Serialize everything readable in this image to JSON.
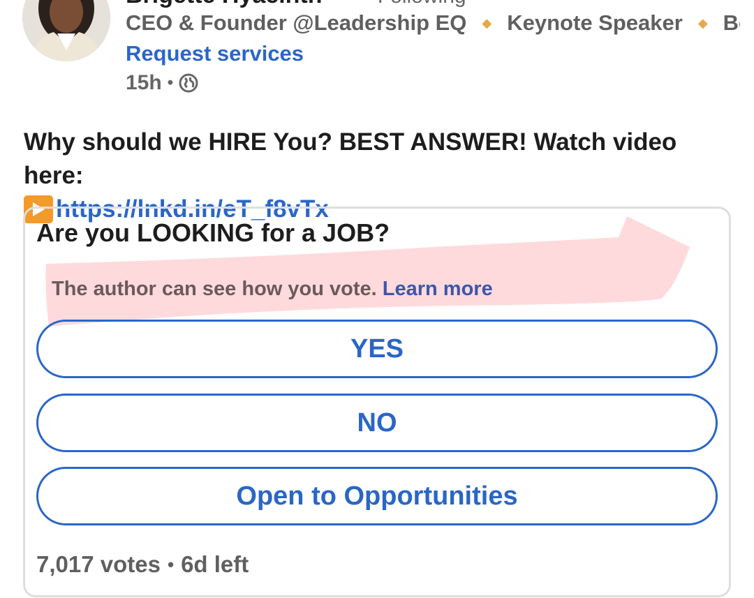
{
  "post": {
    "author": {
      "name": "Brigette Hyacinth",
      "follow_status": "• Following",
      "headline": [
        "CEO & Founder @Leadership EQ",
        "Keynote Speaker",
        "Be…"
      ],
      "headline_separator": "◆",
      "request_services": "Request services",
      "time_ago": "15h",
      "meta_dot": "•",
      "visibility_icon": "globe-icon"
    },
    "text": "Why should we HIRE You? BEST ANSWER! Watch video here:",
    "link": "https://lnkd.in/eT_f8vTx",
    "play_icon": "play-button-icon"
  },
  "poll": {
    "question": "Are you LOOKING for a JOB?",
    "note": "The author can see how you vote.",
    "learn_more": "Learn more",
    "options": [
      "YES",
      "NO",
      "Open to Opportunities"
    ],
    "votes": "7,017 votes",
    "time_left": "6d left",
    "footer_dot": "•"
  },
  "colors": {
    "accent_blue": "#2a66c7",
    "highlight_pink": "#ffd6d8",
    "separator_orange": "#e8a848"
  }
}
